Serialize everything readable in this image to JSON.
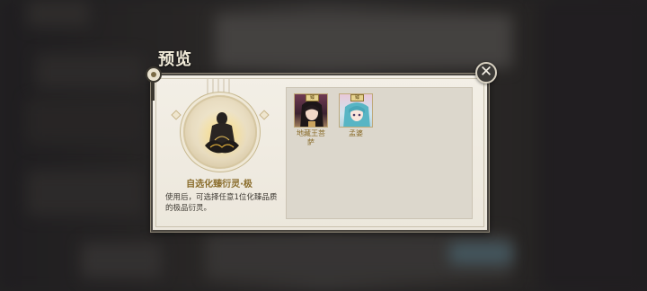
{
  "dialog": {
    "title": "预览",
    "close_label": "✕"
  },
  "item": {
    "name": "自选化臻衍灵·极",
    "description": "使用后，可选择任意1位化臻品质的极品衍灵。",
    "icon": "lotus-emblem-icon"
  },
  "preview": {
    "characters": [
      {
        "name": "地藏王菩萨",
        "badge": "臻",
        "icon": "dark-haired-character-portrait"
      },
      {
        "name": "孟婆",
        "badge": "臻",
        "icon": "teal-haired-character-portrait"
      }
    ]
  },
  "colors": {
    "frame": "#f3efe6",
    "accent_gold": "#8a6d2c",
    "preview_bg": "#dcd7cc",
    "overlay": "#2b2a2b"
  }
}
